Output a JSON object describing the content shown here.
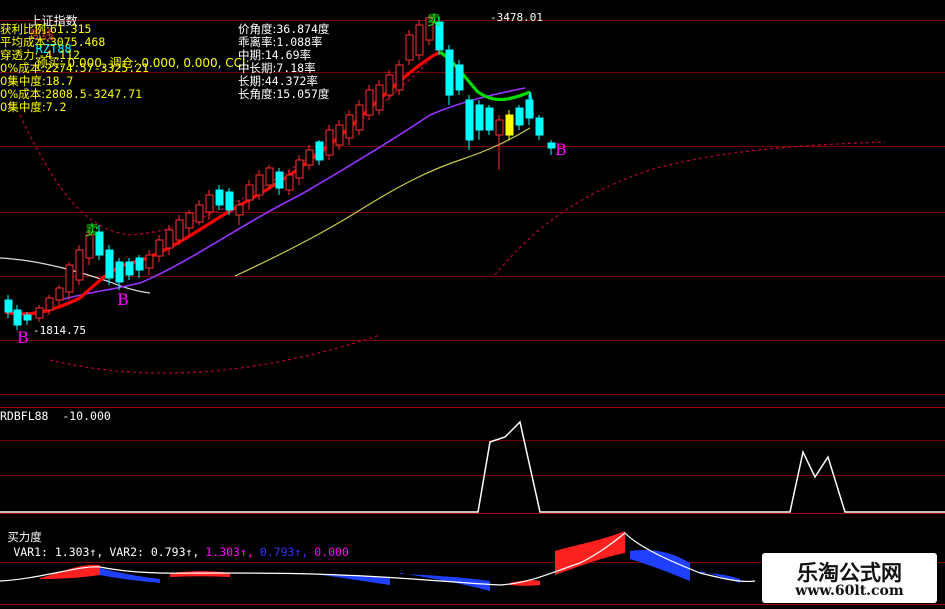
{
  "header": {
    "title": "上证指数",
    "period": "周线",
    "indicator": "RZT88",
    "tail": "预买: 0.000, 调仓: 0.000, 0.000, CCI:",
    "tail_color": "#ffff00"
  },
  "info_left": [
    {
      "label": "获利比例:",
      "value": "61.315"
    },
    {
      "label": "平均成本:",
      "value": "3075.468"
    },
    {
      "label": "穿透力:",
      "value": "-4.112"
    },
    {
      "label": "0%成本:",
      "value": "2274.57-3325.21"
    },
    {
      "label": "0集中度:",
      "value": "18.7"
    },
    {
      "label": "0%成本:",
      "value": "2808.5-3247.71"
    },
    {
      "label": "0集中度:",
      "value": "7.2"
    }
  ],
  "info_right": [
    {
      "label": "价角度:",
      "value": "36.874度"
    },
    {
      "label": "乖离率:",
      "value": "1.088率"
    },
    {
      "label": "中期:",
      "value": "14.69率"
    },
    {
      "label": "中长期:",
      "value": "7.18率"
    },
    {
      "label": "长期:",
      "value": "44.372率"
    },
    {
      "label": "长角度:",
      "value": "15.057度"
    }
  ],
  "price_labels": {
    "high": "3478.01",
    "low": "1814.75",
    "buy_marks": [
      "B",
      "B",
      "B"
    ],
    "sell_marks": [
      "卖",
      "卖"
    ]
  },
  "panel2": {
    "name": "RDBFL88",
    "value": "-10.000"
  },
  "panel3": {
    "name": "买力度",
    "items": [
      {
        "text": "VAR1: 1.303↑,",
        "color": "#ffffff"
      },
      {
        "text": "VAR2: 0.793↑,",
        "color": "#ffffff"
      },
      {
        "text": "1.303↑,",
        "color": "#ff00ff"
      },
      {
        "text": "0.793↑,",
        "color": "#3333ff"
      },
      {
        "text": "0.000",
        "color": "#ff00ff"
      }
    ]
  },
  "watermark": {
    "line1": "乐淘公式网",
    "line2": "www.60lt.com"
  },
  "colors": {
    "up": "#ff3030",
    "down": "#00ffff",
    "ma_red": "#ff0000",
    "ma_purple": "#9933ff",
    "ma_yellow": "#cccc44",
    "ma_white": "#dddddd",
    "band": "#bb0033"
  }
}
